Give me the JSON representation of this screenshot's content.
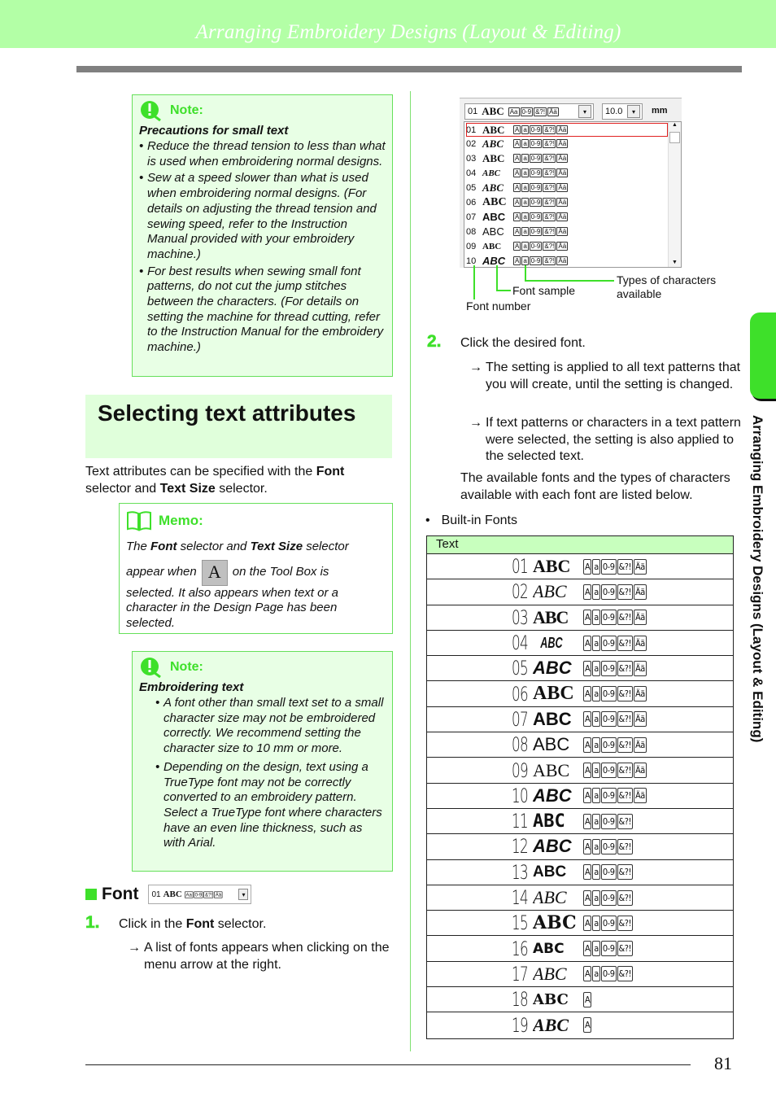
{
  "header": {
    "title": "Arranging Embroidery Designs (Layout & Editing)"
  },
  "note1": {
    "label": "Note:",
    "subtitle": "Precautions for small text",
    "bullets": [
      "Reduce the thread tension to less than what is used when embroidering normal designs.",
      "Sew at a speed slower than what is used when embroidering normal designs. (For details on adjusting the thread tension and sewing speed, refer to the Instruction Manual provided with your embroidery machine.)",
      "For best results when sewing small font patterns, do not cut the jump stitches between the characters. (For details on setting the machine for thread cutting, refer to the Instruction Manual for the embroidery machine.)"
    ]
  },
  "section": {
    "title": "Selecting text attributes",
    "intro_pre": "Text attributes can be specified with the ",
    "intro_b1": "Font",
    "intro_mid": " selector and ",
    "intro_b2": "Text Size",
    "intro_post": " selector."
  },
  "memo": {
    "label": "Memo:",
    "l1_pre": "The ",
    "l1_b1": "Font",
    "l1_mid": " selector and ",
    "l1_b2": "Text Size",
    "l1_post": " selector",
    "l2_pre": "appear when",
    "tool_glyph": "A",
    "l2_post": "on the Tool Box is",
    "rest": "selected. It also appears when text or a character in the Design Page has been selected."
  },
  "note2": {
    "label": "Note:",
    "subtitle": "Embroidering text",
    "bullets": [
      "A font other than small text set to a small character size may not be embroidered correctly. We recommend setting the character size to 10 mm or more.",
      "Depending on the design, text using a TrueType font may not be correctly converted to an embroidery pattern. Select a TrueType font where characters have an even line thickness, such as with Arial."
    ]
  },
  "font_section": {
    "heading": "Font",
    "selector": {
      "num": "01",
      "sample": "ABC",
      "glyphs": [
        "Aa",
        "0-9",
        "&?!",
        "Ää"
      ]
    },
    "step1": {
      "num": "1.",
      "pre": "Click in the ",
      "bold": "Font",
      "post": " selector."
    },
    "step1_result": "A list of fonts appears when clicking on the menu arrow at the right."
  },
  "font_window": {
    "selected": {
      "num": "01",
      "sample": "ABC"
    },
    "size_value": "10.0",
    "size_unit": "mm",
    "rows": [
      {
        "num": "01",
        "sample": "ABC"
      },
      {
        "num": "02",
        "sample": "ABC"
      },
      {
        "num": "03",
        "sample": "ABC"
      },
      {
        "num": "04",
        "sample": "ABC"
      },
      {
        "num": "05",
        "sample": "ABC"
      },
      {
        "num": "06",
        "sample": "ABC"
      },
      {
        "num": "07",
        "sample": "ABC"
      },
      {
        "num": "08",
        "sample": "ABC"
      },
      {
        "num": "09",
        "sample": "ABC"
      },
      {
        "num": "10",
        "sample": "ABC"
      }
    ],
    "glyphs": [
      "Aa",
      "0-9",
      "&?!",
      "Ää"
    ],
    "callouts": {
      "types": "Types of characters available",
      "sample": "Font sample",
      "number": "Font number"
    }
  },
  "step2": {
    "num": "2.",
    "text": "Click the desired font.",
    "result1": "The setting is applied to all text patterns that you will create, until the setting is changed.",
    "result2": "If text patterns or characters in a text pattern were selected, the setting is also applied to the selected text.",
    "para": "The available fonts and the types of characters available with each font are listed below.",
    "bullet": "Built-in Fonts"
  },
  "fonts_table": {
    "header": "Text",
    "rows": [
      {
        "num": "01",
        "sample": "ABC",
        "glyphs": [
          "A",
          "a",
          "0-9",
          "&?!",
          "Ää"
        ]
      },
      {
        "num": "02",
        "sample": "ABC",
        "glyphs": [
          "A",
          "a",
          "0-9",
          "&?!",
          "Ää"
        ]
      },
      {
        "num": "03",
        "sample": "ABC",
        "glyphs": [
          "A",
          "a",
          "0-9",
          "&?!",
          "Ää"
        ]
      },
      {
        "num": "04",
        "sample": "ABC",
        "glyphs": [
          "A",
          "a",
          "0-9",
          "&?!",
          "Ää"
        ]
      },
      {
        "num": "05",
        "sample": "ABC",
        "glyphs": [
          "A",
          "a",
          "0-9",
          "&?!",
          "Ää"
        ]
      },
      {
        "num": "06",
        "sample": "ABC",
        "glyphs": [
          "A",
          "a",
          "0-9",
          "&?!",
          "Ää"
        ]
      },
      {
        "num": "07",
        "sample": "ABC",
        "glyphs": [
          "A",
          "a",
          "0-9",
          "&?!",
          "Ää"
        ]
      },
      {
        "num": "08",
        "sample": "ABC",
        "glyphs": [
          "A",
          "a",
          "0-9",
          "&?!",
          "Ää"
        ]
      },
      {
        "num": "09",
        "sample": "ABC",
        "glyphs": [
          "A",
          "a",
          "0-9",
          "&?!",
          "Ää"
        ]
      },
      {
        "num": "10",
        "sample": "ABC",
        "glyphs": [
          "A",
          "a",
          "0-9",
          "&?!",
          "Ää"
        ]
      },
      {
        "num": "11",
        "sample": "ABC",
        "glyphs": [
          "A",
          "a",
          "0-9",
          "&?!"
        ]
      },
      {
        "num": "12",
        "sample": "ABC",
        "glyphs": [
          "A",
          "a",
          "0-9",
          "&?!"
        ]
      },
      {
        "num": "13",
        "sample": "ABC",
        "glyphs": [
          "A",
          "a",
          "0-9",
          "&?!"
        ]
      },
      {
        "num": "14",
        "sample": "ABC",
        "glyphs": [
          "A",
          "a",
          "0-9",
          "&?!"
        ]
      },
      {
        "num": "15",
        "sample": "ABC",
        "glyphs": [
          "A",
          "a",
          "0-9",
          "&?!"
        ]
      },
      {
        "num": "16",
        "sample": "ABC",
        "glyphs": [
          "A",
          "a",
          "0-9",
          "&?!"
        ]
      },
      {
        "num": "17",
        "sample": "ABC",
        "glyphs": [
          "A",
          "a",
          "0-9",
          "&?!"
        ]
      },
      {
        "num": "18",
        "sample": "ABC",
        "glyphs": [
          "A"
        ]
      },
      {
        "num": "19",
        "sample": "ABC",
        "glyphs": [
          "A"
        ]
      }
    ]
  },
  "side_tab": {
    "text": "Arranging Embroidery Designs (Layout & Editing)"
  },
  "footer": {
    "page_number": "81"
  },
  "colors": {
    "accent_green": "#3ee02a",
    "header_green": "#b3ffa6",
    "note_bg": "#e8ffe5",
    "selection_red": "#e02020"
  }
}
